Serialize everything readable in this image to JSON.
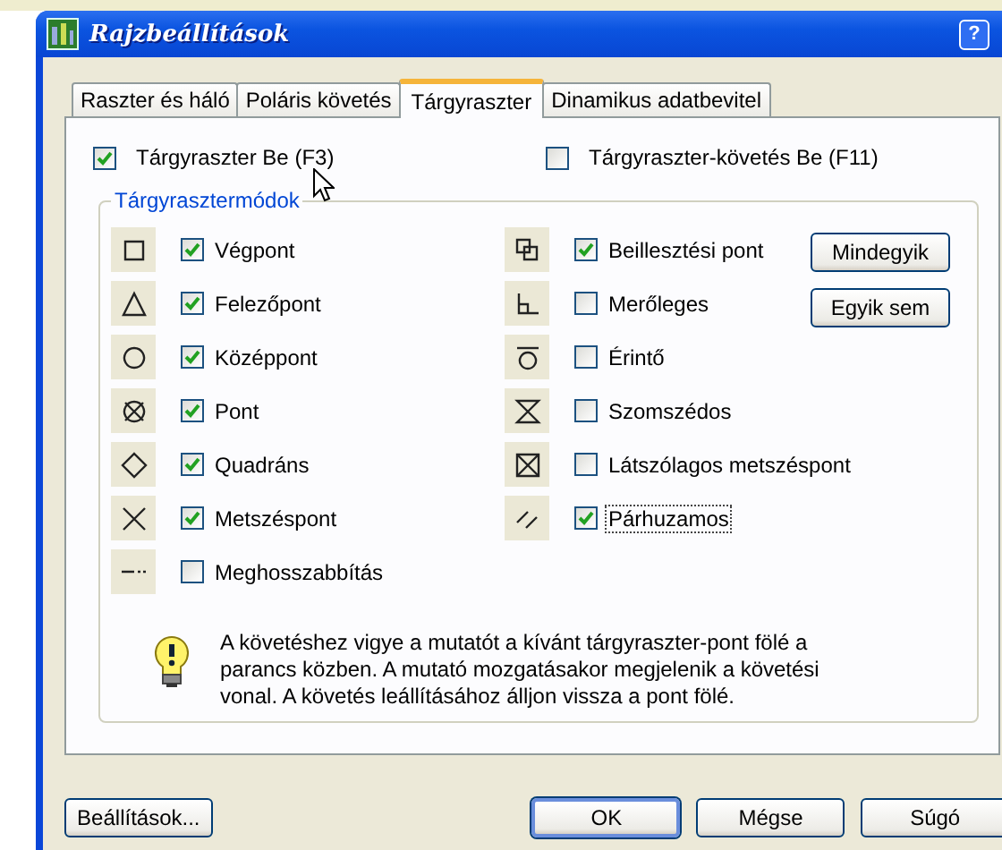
{
  "window": {
    "title": "Rajzbeállítások",
    "help": "?"
  },
  "tabs": [
    {
      "label": "Raszter és háló",
      "selected": false
    },
    {
      "label": "Poláris követés",
      "selected": false
    },
    {
      "label": "Tárgyraszter",
      "selected": true
    },
    {
      "label": "Dinamikus adatbevitel",
      "selected": false
    }
  ],
  "options": [
    {
      "label": "Tárgyraszter Be (F3)",
      "checked": true
    },
    {
      "label": "Tárgyraszter-követés Be (F11)",
      "checked": false
    }
  ],
  "group": {
    "title": "Tárgyrasztermódok",
    "modes_left": [
      {
        "label": "Végpont",
        "checked": true,
        "focused": false
      },
      {
        "label": "Felezőpont",
        "checked": true,
        "focused": false
      },
      {
        "label": "Középpont",
        "checked": true,
        "focused": false
      },
      {
        "label": "Pont",
        "checked": true,
        "focused": false
      },
      {
        "label": "Quadráns",
        "checked": true,
        "focused": false
      },
      {
        "label": "Metszéspont",
        "checked": true,
        "focused": false
      },
      {
        "label": "Meghosszabbítás",
        "checked": false,
        "focused": false
      }
    ],
    "modes_right": [
      {
        "label": "Beillesztési pont",
        "checked": true,
        "focused": false
      },
      {
        "label": "Merőleges",
        "checked": false,
        "focused": false
      },
      {
        "label": "Érintő",
        "checked": false,
        "focused": false
      },
      {
        "label": "Szomszédos",
        "checked": false,
        "focused": false
      },
      {
        "label": "Látszólagos metszéspont",
        "checked": false,
        "focused": false
      },
      {
        "label": "Párhuzamos",
        "checked": true,
        "focused": true
      }
    ],
    "buttons": [
      "Mindegyik",
      "Egyik sem"
    ],
    "tip": "A követéshez vigye a mutatót a kívánt tárgyraszter-pont fölé a parancs közben. A mutató mozgatásakor megjelenik a követési vonal. A követés leállításához álljon vissza a pont fölé."
  },
  "buttons": [
    {
      "label": "Beállítások...",
      "default": false
    },
    {
      "label": "OK",
      "default": true
    },
    {
      "label": "Mégse",
      "default": false
    },
    {
      "label": "Súgó",
      "default": false
    }
  ]
}
